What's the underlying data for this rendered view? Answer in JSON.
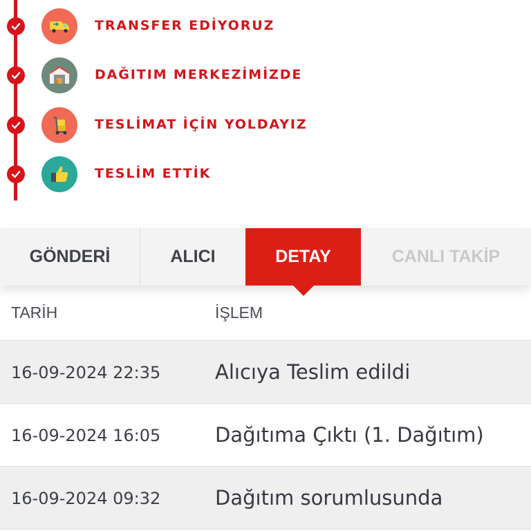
{
  "timeline": {
    "steps": [
      {
        "label": "TRANSFER EDİYORUZ",
        "icon": "truck-icon",
        "color": "#f06a55"
      },
      {
        "label": "DAĞITIM MERKEZİMİZDE",
        "icon": "warehouse-icon",
        "color": "#6e8a7d"
      },
      {
        "label": "TESLİMAT İÇİN YOLDAYIZ",
        "icon": "hand-trolley-icon",
        "color": "#f06a55"
      },
      {
        "label": "TESLİM ETTİK",
        "icon": "thumbs-up-icon",
        "color": "#2aa89a"
      }
    ],
    "accent_color": "#d6141a"
  },
  "tabs": [
    {
      "label": "GÖNDERİ",
      "state": "default"
    },
    {
      "label": "ALICI",
      "state": "default"
    },
    {
      "label": "DETAY",
      "state": "active"
    },
    {
      "label": "CANLI TAKİP",
      "state": "disabled"
    }
  ],
  "table": {
    "headers": {
      "date": "TARİH",
      "operation": "İŞLEM"
    },
    "rows": [
      {
        "date": "16-09-2024 22:35",
        "operation": "Alıcıya Teslim edildi"
      },
      {
        "date": "16-09-2024 16:05",
        "operation": "Dağıtıma Çıktı (1. Dağıtım)"
      },
      {
        "date": "16-09-2024 09:32",
        "operation": "Dağıtım sorumlusunda"
      }
    ]
  }
}
